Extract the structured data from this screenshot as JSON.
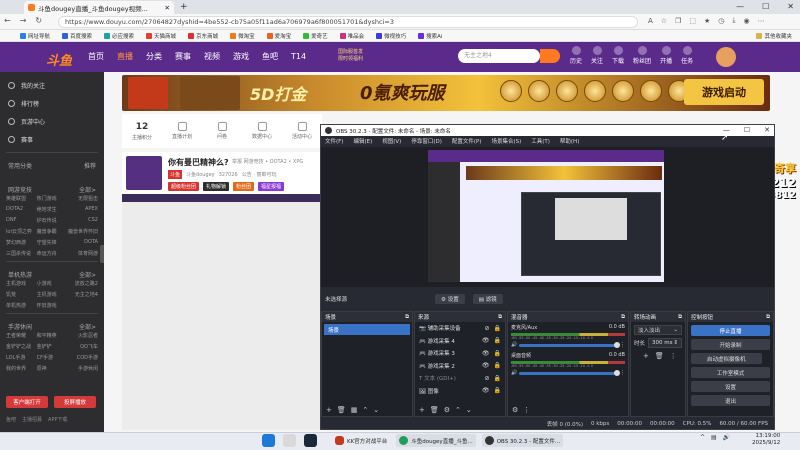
{
  "browser": {
    "tab_title": "斗鱼dougey直播_斗鱼dougey视频...",
    "new_tab": "+",
    "url": "https://www.douyu.com/27064827dyshid=4be552-cb75a05f11ad6a706979a6f800051701&dyshci=3",
    "bookmarks": [
      "网址导航",
      "百度搜索",
      "必应搜索",
      "天猫商城",
      "京东商城",
      "微淘宝",
      "爱淘宝",
      "爱奇艺",
      "唯品会",
      "微视技巧",
      "搜索Ai"
    ],
    "bookmarks_right": "其他收藏夹"
  },
  "douyu": {
    "logo": "斗鱼",
    "nav": [
      "首页",
      "直播",
      "分类",
      "赛事",
      "视频",
      "游戏",
      "鱼吧",
      "T14"
    ],
    "nav_active": "直播",
    "search_placeholder": "无主之地4",
    "search_promo_top": "国际服首发",
    "search_promo_bottom": "限时领福利",
    "header_icons": [
      "历史",
      "关注",
      "下载",
      "粉丝团",
      "开播",
      "任务"
    ],
    "banner": {
      "text1": "5D打金",
      "text2": "0氪爽玩服",
      "button": "游戏启动"
    },
    "stats": [
      {
        "value": "12",
        "label": "主播积分"
      },
      {
        "value": "",
        "label": "直播计划"
      },
      {
        "value": "",
        "label": "问卷"
      },
      {
        "value": "",
        "label": "数据中心"
      },
      {
        "value": "",
        "label": "活动中心"
      }
    ],
    "room": {
      "title": "你有曼巴精神么?",
      "meta": "举报  网游竞技 • DOTA2 • XPG",
      "badge": "斗鱼",
      "streamer": "斗鱼dougey",
      "fans": "327026",
      "extra": "公告 · 丽郎可玩",
      "tags": [
        "超级粉丝团",
        "礼物解锁",
        "粉丝团",
        "福星报福"
      ]
    },
    "overlay": {
      "line1": "推鲸奇享",
      "line2": "kook:212",
      "line3": "V:XZolu8812"
    }
  },
  "sidebar": {
    "items": [
      "我的关注",
      "排行榜",
      "页游中心",
      "赛事"
    ],
    "sections": [
      {
        "title": "常用分类",
        "more": "推荐",
        "cells": []
      },
      {
        "title": "网游竞技",
        "more": "全部>",
        "cells": [
          "英雄联盟",
          "热门游戏",
          "无限狙击",
          "DOTA2",
          "绝地求生",
          "APEX",
          "DNF",
          "炉石传说",
          "CS2",
          "lol云顶之弈",
          "魔兽争霸",
          "魔兽世界怀旧",
          "梦幻西游",
          "守望先锋",
          "DOTA",
          "三国杀传说",
          "命运方舟",
          "体育网游"
        ]
      },
      {
        "title": "单机热游",
        "more": "全部>",
        "cells": [
          "主机游戏",
          "小游戏",
          "流放之路2",
          "饥荒",
          "主机游戏",
          "无主之地4",
          "单机热游",
          "怀旧游戏",
          ""
        ]
      },
      {
        "title": "手游休闲",
        "more": "全部>",
        "cells": [
          "王者荣耀",
          "和平精英",
          "火影忍者",
          "金铲铲之战",
          "金铲铲",
          "QQ飞车",
          "LOL手游",
          "CF手游",
          "COD手游",
          "我的世界",
          "原神",
          "手游休闲"
        ]
      }
    ],
    "btn1": "客户端打开",
    "btn2": "投屏播放",
    "footer": [
      "鱼吧",
      "主播招募",
      "APP下载"
    ]
  },
  "obs": {
    "title": "OBS 30.2.3 - 配置文件: 未命名 - 场景: 未命名",
    "menu": [
      "文件(F)",
      "编辑(E)",
      "视图(V)",
      "停靠窗口(D)",
      "配置文件(P)",
      "场景集合(S)",
      "工具(T)",
      "帮助(H)"
    ],
    "no_source": "未选择源",
    "settings_btn": "设置",
    "filters_btn": "滤镜",
    "scenes_title": "场景",
    "scene_items": [
      "场景"
    ],
    "sources_title": "来源",
    "sources": [
      "辅助采集设备",
      "游戏采集 4",
      "游戏采集 3",
      "游戏采集 2",
      "文本 (GDI+)",
      "图像"
    ],
    "mixer_title": "混音器",
    "mixer": [
      {
        "name": "麦克风/Aux",
        "db": "0.0 dB"
      },
      {
        "name": "桌面音频",
        "db": "0.0 dB"
      }
    ],
    "meter_scale": "-60 -55 -50 -45 -40 -35 -30 -25 -20 -15 -10 -5 0",
    "trans_title": "转场动画",
    "trans_value": "淡入淡出",
    "duration_label": "时长",
    "duration_value": "300 ms",
    "ctrl_title": "控制按钮",
    "controls": [
      "停止直播",
      "开始录制",
      "启动虚拟摄像机",
      "工作室模式",
      "设置",
      "退出"
    ],
    "status": {
      "dropped": "丢帧 0 (0.0%)",
      "bitrate": "0 kbps",
      "stream_time": "00:00:00",
      "rec_time": "00:00:00",
      "cpu": "CPU: 0.5%",
      "fps": "60.00 / 60.00 FPS"
    }
  },
  "taskbar": {
    "apps": [
      "KK官方对战平台",
      "斗鱼dougey直播_斗鱼...",
      "OBS 30.2.3 - 配置文件..."
    ],
    "time": "13:19:00",
    "date": "2025/9/12"
  },
  "colors": {
    "douyu_purple": "#5b2b8c",
    "douyu_orange": "#ff7a1f",
    "obs_blue": "#3a72c5"
  }
}
